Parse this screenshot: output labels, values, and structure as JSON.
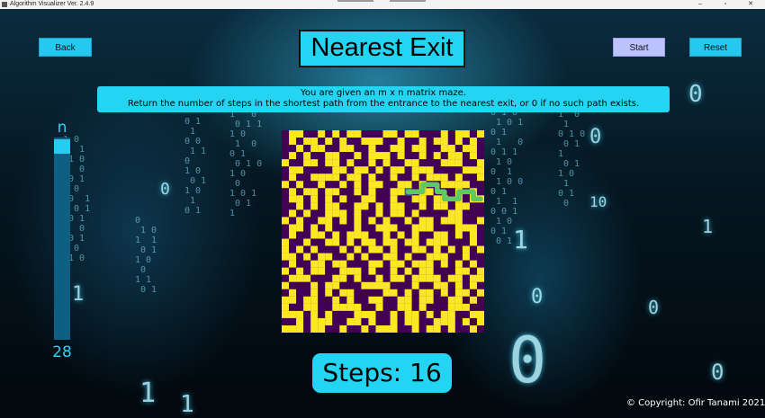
{
  "window": {
    "title": "Algorithm Visualizer Ver. 2.4.9"
  },
  "buttons": {
    "back": "Back",
    "start": "Start",
    "reset": "Reset"
  },
  "page": {
    "title": "Nearest Exit",
    "description_line1": "You are given an m x n matrix maze.",
    "description_line2": "Return the number of steps in the shortest path from the entrance to the nearest exit, or 0 if no such path exists."
  },
  "slider": {
    "label": "n",
    "value": "28"
  },
  "steps": "Steps: 16",
  "copyright": "© Copyright: Ofir Tanami 2021",
  "colors": {
    "accent": "#23d5f2",
    "start_button": "#bcc3ff",
    "maze_open": "#fde725",
    "maze_wall": "#440154",
    "maze_path": "#5ec962",
    "maze_entrance": "#31688e"
  },
  "maze": {
    "size": 28,
    "rows": [
      "0110010101100011011000101101",
      "0101101010011100100101101010",
      "0010110011001001101100110110",
      "0101001100101110100101011010",
      "1001101101001010011000111001",
      "0110000110110101101110000111",
      "0100111101101001001011101001",
      "1010010010101100110100111100",
      "0101101100101001110110001010",
      "0110101010011001001101101011",
      "0010101100110101100101101100",
      "0101001110100101101000011000",
      "1010011010101010010110111001",
      "0110101000100111001110001110",
      "0100110101110010101001101010",
      "1001001101011011011011100010",
      "1010100010101101001101010101",
      "1101011001010011010011100100",
      "0100110110001101101110101010",
      "1010110011101001010110001101",
      "0111000110100101101111011011",
      "1000101100011110001001101010",
      "0100101011000011010110101101",
      "1101100101001100110110011010",
      "1001100111100100110100011100",
      "1110101000111001011010110011",
      "0010111001101001011001110101",
      "1110110010010111001011010010"
    ],
    "path": [
      [
        8,
        17
      ],
      [
        8,
        18
      ],
      [
        8,
        19
      ],
      [
        7,
        19
      ],
      [
        7,
        20
      ],
      [
        7,
        21
      ],
      [
        8,
        21
      ],
      [
        8,
        22
      ],
      [
        9,
        22
      ],
      [
        9,
        23
      ],
      [
        9,
        24
      ],
      [
        8,
        24
      ],
      [
        8,
        25
      ],
      [
        8,
        26
      ],
      [
        9,
        26
      ],
      [
        9,
        27
      ]
    ],
    "entrance": [
      8,
      17
    ]
  }
}
